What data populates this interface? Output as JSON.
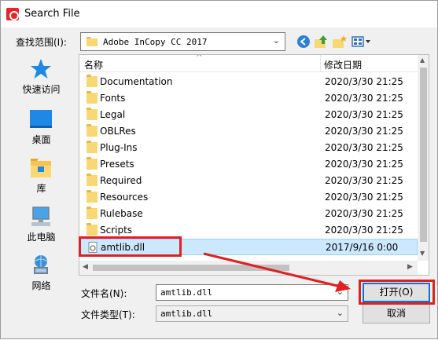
{
  "window": {
    "title": "Search File"
  },
  "lookin": {
    "label": "查找范围(I):",
    "value": "Adobe InCopy CC 2017"
  },
  "toolbar": {
    "back_icon": "back-arrow-icon",
    "up_icon": "up-folder-icon",
    "new_folder_icon": "new-folder-icon",
    "view_icon": "view-menu-icon"
  },
  "places": [
    {
      "label": "快速访问",
      "icon": "quick-access-star-icon"
    },
    {
      "label": "桌面",
      "icon": "desktop-icon"
    },
    {
      "label": "库",
      "icon": "libraries-icon"
    },
    {
      "label": "此电脑",
      "icon": "this-pc-icon"
    },
    {
      "label": "网络",
      "icon": "network-icon"
    }
  ],
  "list": {
    "col_name": "名称",
    "col_date": "修改日期",
    "rows": [
      {
        "name": "Documentation",
        "date": "2020/3/30 21:25",
        "type": "folder"
      },
      {
        "name": "Fonts",
        "date": "2020/3/30 21:25",
        "type": "folder"
      },
      {
        "name": "Legal",
        "date": "2020/3/30 21:25",
        "type": "folder"
      },
      {
        "name": "OBLRes",
        "date": "2020/3/30 21:25",
        "type": "folder"
      },
      {
        "name": "Plug-Ins",
        "date": "2020/3/30 21:25",
        "type": "folder"
      },
      {
        "name": "Presets",
        "date": "2020/3/30 21:25",
        "type": "folder"
      },
      {
        "name": "Required",
        "date": "2020/3/30 21:25",
        "type": "folder"
      },
      {
        "name": "Resources",
        "date": "2020/3/30 21:25",
        "type": "folder"
      },
      {
        "name": "Rulebase",
        "date": "2020/3/30 21:25",
        "type": "folder"
      },
      {
        "name": "Scripts",
        "date": "2020/3/30 21:25",
        "type": "folder"
      },
      {
        "name": "amtlib.dll",
        "date": "2017/9/16 0:00",
        "type": "file"
      }
    ]
  },
  "filename": {
    "label": "文件名(N):",
    "value": "amtlib.dll"
  },
  "filetype": {
    "label": "文件类型(T):",
    "value": "amtlib.dll"
  },
  "buttons": {
    "open": "打开(O)",
    "cancel": "取消"
  },
  "colors": {
    "annotation_red": "#e02020",
    "selection": "#cce8ff",
    "folder": "#f8d775"
  }
}
